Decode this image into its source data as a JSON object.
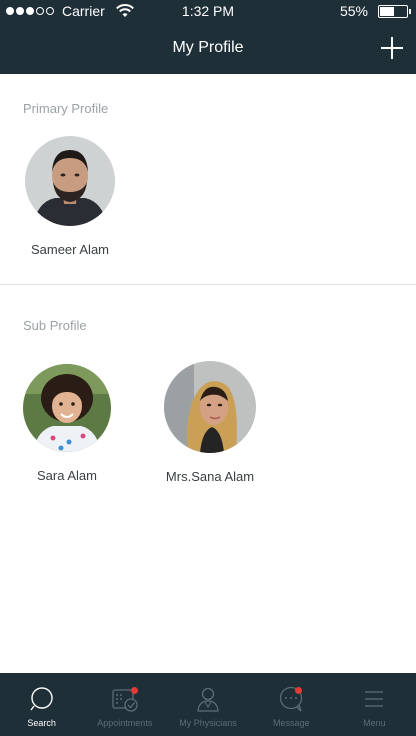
{
  "status_bar": {
    "carrier": "Carrier",
    "time": "1:32 PM",
    "battery": "55%",
    "battery_level": 0.55
  },
  "header": {
    "title": "My Profile",
    "add_icon": "plus-icon"
  },
  "primary_section": {
    "label": "Primary Profile",
    "profiles": [
      {
        "name": "Sameer Alam",
        "avatar_icon": "user-photo"
      }
    ]
  },
  "sub_section": {
    "label": "Sub Profile",
    "profiles": [
      {
        "name": "Sara Alam",
        "avatar_icon": "user-photo"
      },
      {
        "name": "Mrs.Sana Alam",
        "avatar_icon": "user-photo"
      }
    ]
  },
  "tab_bar": {
    "tabs": [
      {
        "label": "Search",
        "icon": "search-icon",
        "active": true
      },
      {
        "label": "Appointments",
        "icon": "calendar-icon",
        "badge": true
      },
      {
        "label": "My Physicians",
        "icon": "physician-icon"
      },
      {
        "label": "Message",
        "icon": "message-icon",
        "badge": true
      },
      {
        "label": "Menu",
        "icon": "menu-icon"
      }
    ]
  },
  "colors": {
    "nav_bg": "#1f2f38",
    "badge": "#e53935",
    "section_label": "#9aa2a7"
  }
}
